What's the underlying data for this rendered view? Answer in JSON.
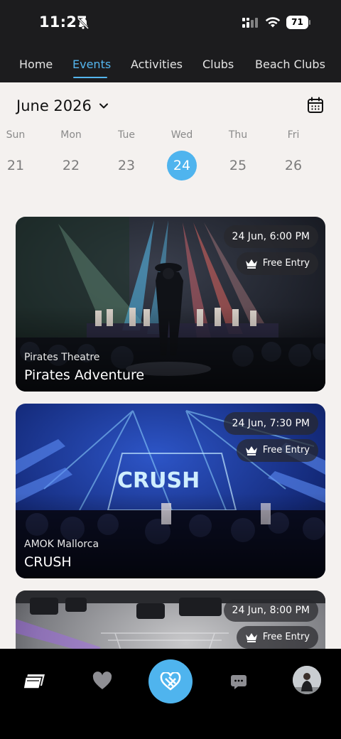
{
  "status_bar": {
    "time": "11:27",
    "battery": "71"
  },
  "nav": {
    "tabs": [
      {
        "label": "Home"
      },
      {
        "label": "Events",
        "active": true
      },
      {
        "label": "Activities"
      },
      {
        "label": "Clubs"
      },
      {
        "label": "Beach Clubs"
      }
    ]
  },
  "calendar": {
    "month_label": "June 2026",
    "days": [
      {
        "name": "Sun",
        "date": "21"
      },
      {
        "name": "Mon",
        "date": "22"
      },
      {
        "name": "Tue",
        "date": "23"
      },
      {
        "name": "Wed",
        "date": "24",
        "selected": true
      },
      {
        "name": "Thu",
        "date": "25"
      },
      {
        "name": "Fri",
        "date": "26"
      }
    ]
  },
  "events": [
    {
      "datetime": "24 Jun, 6:00 PM",
      "entry": "Free Entry",
      "venue": "Pirates Theatre",
      "title": "Pirates Adventure"
    },
    {
      "datetime": "24 Jun, 7:30 PM",
      "entry": "Free Entry",
      "venue": "AMOK Mallorca",
      "title": "CRUSH",
      "sign_text": "CRUSH"
    },
    {
      "datetime": "24 Jun, 8:00 PM",
      "entry": "Free Entry",
      "venue": "",
      "title": ""
    }
  ],
  "bottom_nav": {
    "icons": [
      "tickets-icon",
      "heart-icon",
      "brand-heart-icon",
      "chat-icon",
      "avatar"
    ]
  },
  "colors": {
    "accent": "#4fb4ee",
    "bar": "#1c1c1e",
    "content_bg": "#f4f1ef"
  }
}
